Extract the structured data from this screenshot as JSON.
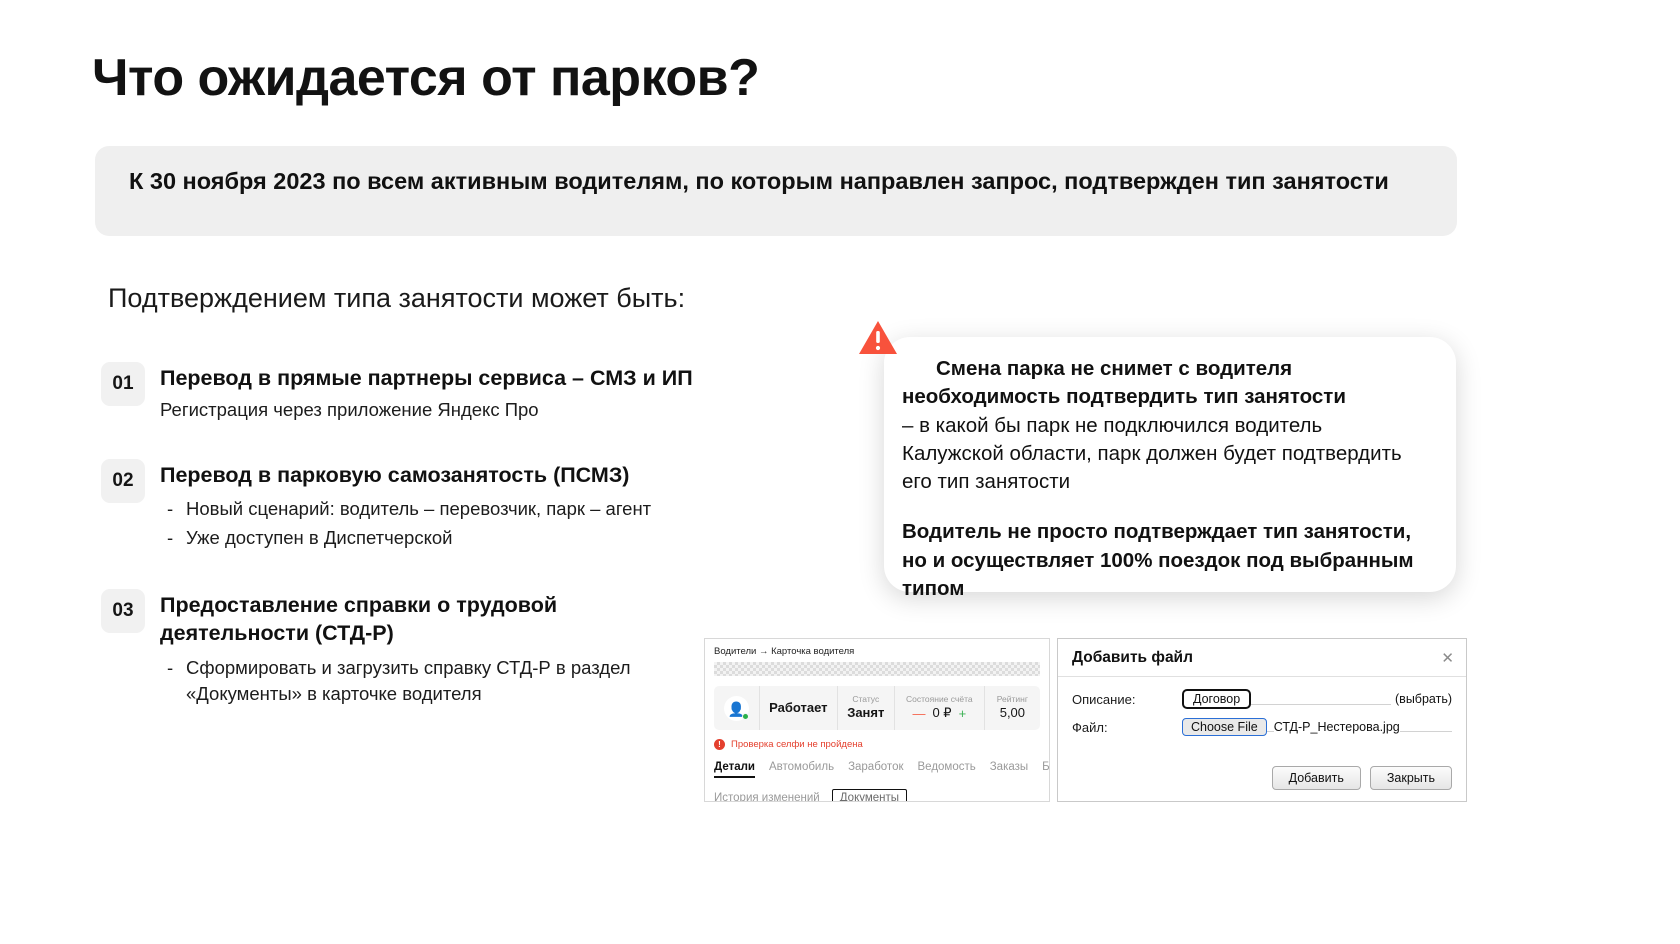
{
  "slide": {
    "title": "Что ожидается от парков?",
    "banner": "К 30 ноября 2023 по всем активным водителям, по которым направлен запрос, подтвержден тип занятости",
    "intro": "Подтверждением типа занятости может быть:",
    "banner_bg": "#efefef"
  },
  "steps": [
    {
      "num": "01",
      "title": "Перевод в прямые партнеры сервиса – СМЗ и ИП",
      "sub": "Регистрация через приложение Яндекс Про",
      "bullets": []
    },
    {
      "num": "02",
      "title": "Перевод в парковую самозанятость (ПСМЗ)",
      "sub": "",
      "bullets": [
        "Новый сценарий: водитель – перевозчик, парк – агент",
        "Уже доступен в Диспетчерской"
      ]
    },
    {
      "num": "03",
      "title": "Предоставление справки о трудовой деятельности (СТД-Р)",
      "sub": "",
      "bullets": [
        "Сформировать и загрузить справку СТД-Р в раздел «Документы» в карточке водителя"
      ]
    }
  ],
  "callout": {
    "icon": "warning-triangle-icon",
    "icon_color": "#f8523c",
    "bold_1": "Смена парка не снимет с водителя необходимость подтвердить тип занятости",
    "regular_1": "– в какой бы парк не подключился водитель Калужской области, парк должен будет подтвердить его тип занятости",
    "bold_2": "Водитель не просто подтверждает тип занятости, но и осуществляет 100% поездок под выбранным типом"
  },
  "dashboard": {
    "breadcrumb": "Водители → Карточка водителя",
    "work_status": "Работает",
    "status_label": "Статус",
    "status_value": "Занят",
    "balance_label": "Состояние счёта",
    "balance_minus": "—",
    "balance_value": "0 ₽",
    "balance_plus": "+",
    "rating_label": "Рейтинг",
    "rating_value": "5,00",
    "alert": "Проверка селфи не пройдена",
    "alert_color": "#e4402e",
    "tabs": [
      "Детали",
      "Автомобиль",
      "Заработок",
      "Ведомость",
      "Заказы",
      "Бонус"
    ],
    "active_tab": "Детали",
    "tabs2": [
      "История изменений",
      "Документы"
    ],
    "highlighted_tab2": "Документы"
  },
  "dialog": {
    "title": "Добавить файл",
    "close": "✕",
    "desc_label": "Описание:",
    "desc_value": "Договор",
    "select_value": "(выбрать)",
    "file_label": "Файл:",
    "choose_button": "Choose File",
    "file_name": "СТД-Р_Нестерова.jpg",
    "submit": "Добавить",
    "cancel": "Закрыть"
  }
}
